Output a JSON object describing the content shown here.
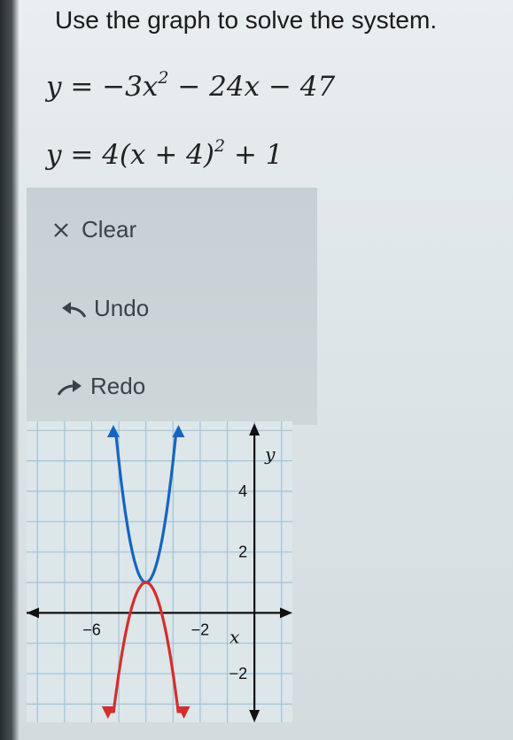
{
  "prompt": "Use the graph to solve the system.",
  "equations": {
    "eq1": {
      "lhs": "y",
      "rhs_a": "= −3x",
      "exp": "2",
      "rhs_b": " − 24x − 47"
    },
    "eq2": {
      "lhs": "y",
      "rhs_a": "= 4(x + 4)",
      "exp": "2",
      "rhs_b": " + 1"
    }
  },
  "toolbar": {
    "clear_label": "Clear",
    "undo_label": "Undo",
    "redo_label": "Redo",
    "clear_icon": "close-icon",
    "undo_icon": "undo-arrow-icon",
    "redo_icon": "redo-arrow-icon"
  },
  "chart_data": {
    "type": "line",
    "xlabel": "x",
    "ylabel": "y",
    "xlim": [
      -8.4,
      1.4
    ],
    "ylim": [
      -3.6,
      6.3
    ],
    "grid": true,
    "x_tick_labels": [
      {
        "value": -6,
        "text": "−6"
      },
      {
        "value": -2,
        "text": "−2"
      }
    ],
    "y_tick_labels": [
      {
        "value": 4,
        "text": "4"
      },
      {
        "value": 2,
        "text": "2"
      },
      {
        "value": -2,
        "text": "−2"
      }
    ],
    "series": [
      {
        "color": "#1565c0",
        "formula": "4(x+4)^2+1",
        "x": [
          -5.2,
          -4.8,
          -4.4,
          -4.0,
          -3.6,
          -3.2,
          -2.8
        ],
        "y": [
          6.76,
          3.56,
          1.64,
          1.0,
          1.64,
          3.56,
          6.76
        ]
      },
      {
        "color": "#d32f2f",
        "formula": "-3x^2-24x-47",
        "x": [
          -5.4,
          -5.0,
          -4.5,
          -4.0,
          -3.5,
          -3.0,
          -2.6
        ],
        "y": [
          -4.88,
          -2.0,
          0.25,
          1.0,
          0.25,
          -2.0,
          -4.88
        ]
      }
    ],
    "intersection": {
      "x": -4,
      "y": 1
    }
  },
  "colors": {
    "axis": "#111111",
    "grid": "#9fc3d8",
    "blue": "#1565c0",
    "red": "#d32f2f"
  }
}
